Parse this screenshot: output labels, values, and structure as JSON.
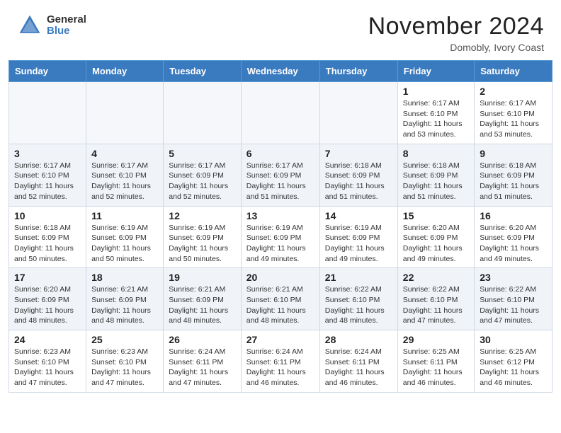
{
  "header": {
    "logo_general": "General",
    "logo_blue": "Blue",
    "month_title": "November 2024",
    "location": "Domobly, Ivory Coast"
  },
  "calendar": {
    "days_of_week": [
      "Sunday",
      "Monday",
      "Tuesday",
      "Wednesday",
      "Thursday",
      "Friday",
      "Saturday"
    ],
    "weeks": [
      [
        {
          "day": "",
          "empty": true
        },
        {
          "day": "",
          "empty": true
        },
        {
          "day": "",
          "empty": true
        },
        {
          "day": "",
          "empty": true
        },
        {
          "day": "",
          "empty": true
        },
        {
          "day": "1",
          "sunrise": "6:17 AM",
          "sunset": "6:10 PM",
          "daylight": "11 hours and 53 minutes."
        },
        {
          "day": "2",
          "sunrise": "6:17 AM",
          "sunset": "6:10 PM",
          "daylight": "11 hours and 53 minutes."
        }
      ],
      [
        {
          "day": "3",
          "sunrise": "6:17 AM",
          "sunset": "6:10 PM",
          "daylight": "11 hours and 52 minutes."
        },
        {
          "day": "4",
          "sunrise": "6:17 AM",
          "sunset": "6:10 PM",
          "daylight": "11 hours and 52 minutes."
        },
        {
          "day": "5",
          "sunrise": "6:17 AM",
          "sunset": "6:09 PM",
          "daylight": "11 hours and 52 minutes."
        },
        {
          "day": "6",
          "sunrise": "6:17 AM",
          "sunset": "6:09 PM",
          "daylight": "11 hours and 51 minutes."
        },
        {
          "day": "7",
          "sunrise": "6:18 AM",
          "sunset": "6:09 PM",
          "daylight": "11 hours and 51 minutes."
        },
        {
          "day": "8",
          "sunrise": "6:18 AM",
          "sunset": "6:09 PM",
          "daylight": "11 hours and 51 minutes."
        },
        {
          "day": "9",
          "sunrise": "6:18 AM",
          "sunset": "6:09 PM",
          "daylight": "11 hours and 51 minutes."
        }
      ],
      [
        {
          "day": "10",
          "sunrise": "6:18 AM",
          "sunset": "6:09 PM",
          "daylight": "11 hours and 50 minutes."
        },
        {
          "day": "11",
          "sunrise": "6:19 AM",
          "sunset": "6:09 PM",
          "daylight": "11 hours and 50 minutes."
        },
        {
          "day": "12",
          "sunrise": "6:19 AM",
          "sunset": "6:09 PM",
          "daylight": "11 hours and 50 minutes."
        },
        {
          "day": "13",
          "sunrise": "6:19 AM",
          "sunset": "6:09 PM",
          "daylight": "11 hours and 49 minutes."
        },
        {
          "day": "14",
          "sunrise": "6:19 AM",
          "sunset": "6:09 PM",
          "daylight": "11 hours and 49 minutes."
        },
        {
          "day": "15",
          "sunrise": "6:20 AM",
          "sunset": "6:09 PM",
          "daylight": "11 hours and 49 minutes."
        },
        {
          "day": "16",
          "sunrise": "6:20 AM",
          "sunset": "6:09 PM",
          "daylight": "11 hours and 49 minutes."
        }
      ],
      [
        {
          "day": "17",
          "sunrise": "6:20 AM",
          "sunset": "6:09 PM",
          "daylight": "11 hours and 48 minutes."
        },
        {
          "day": "18",
          "sunrise": "6:21 AM",
          "sunset": "6:09 PM",
          "daylight": "11 hours and 48 minutes."
        },
        {
          "day": "19",
          "sunrise": "6:21 AM",
          "sunset": "6:09 PM",
          "daylight": "11 hours and 48 minutes."
        },
        {
          "day": "20",
          "sunrise": "6:21 AM",
          "sunset": "6:10 PM",
          "daylight": "11 hours and 48 minutes."
        },
        {
          "day": "21",
          "sunrise": "6:22 AM",
          "sunset": "6:10 PM",
          "daylight": "11 hours and 48 minutes."
        },
        {
          "day": "22",
          "sunrise": "6:22 AM",
          "sunset": "6:10 PM",
          "daylight": "11 hours and 47 minutes."
        },
        {
          "day": "23",
          "sunrise": "6:22 AM",
          "sunset": "6:10 PM",
          "daylight": "11 hours and 47 minutes."
        }
      ],
      [
        {
          "day": "24",
          "sunrise": "6:23 AM",
          "sunset": "6:10 PM",
          "daylight": "11 hours and 47 minutes."
        },
        {
          "day": "25",
          "sunrise": "6:23 AM",
          "sunset": "6:10 PM",
          "daylight": "11 hours and 47 minutes."
        },
        {
          "day": "26",
          "sunrise": "6:24 AM",
          "sunset": "6:11 PM",
          "daylight": "11 hours and 47 minutes."
        },
        {
          "day": "27",
          "sunrise": "6:24 AM",
          "sunset": "6:11 PM",
          "daylight": "11 hours and 46 minutes."
        },
        {
          "day": "28",
          "sunrise": "6:24 AM",
          "sunset": "6:11 PM",
          "daylight": "11 hours and 46 minutes."
        },
        {
          "day": "29",
          "sunrise": "6:25 AM",
          "sunset": "6:11 PM",
          "daylight": "11 hours and 46 minutes."
        },
        {
          "day": "30",
          "sunrise": "6:25 AM",
          "sunset": "6:12 PM",
          "daylight": "11 hours and 46 minutes."
        }
      ]
    ]
  }
}
